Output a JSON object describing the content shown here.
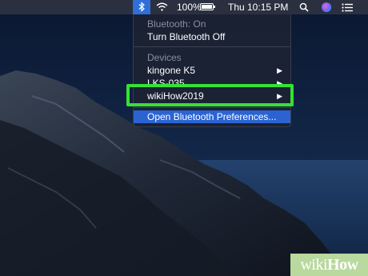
{
  "menubar": {
    "battery_percent": "100%",
    "battery_level": 1.0,
    "clock": "Thu 10:15 PM",
    "icons": [
      "bluetooth-icon",
      "wifi-icon",
      "battery-icon",
      "spotlight-icon",
      "siri-icon",
      "notification-center-icon"
    ]
  },
  "bluetooth_menu": {
    "status": "Bluetooth: On",
    "toggle": "Turn Bluetooth Off",
    "devices_header": "Devices",
    "devices": [
      {
        "label": "kingone K5"
      },
      {
        "label": "LKS-035"
      },
      {
        "label": "wikiHow2019"
      }
    ],
    "preferences": "Open Bluetooth Preferences..."
  },
  "watermark": "wikiHow",
  "colors": {
    "menubar": "#2b3040",
    "highlight": "#34e234",
    "selection": "#2b64d2",
    "watermark_bg": "#b9d99e"
  }
}
